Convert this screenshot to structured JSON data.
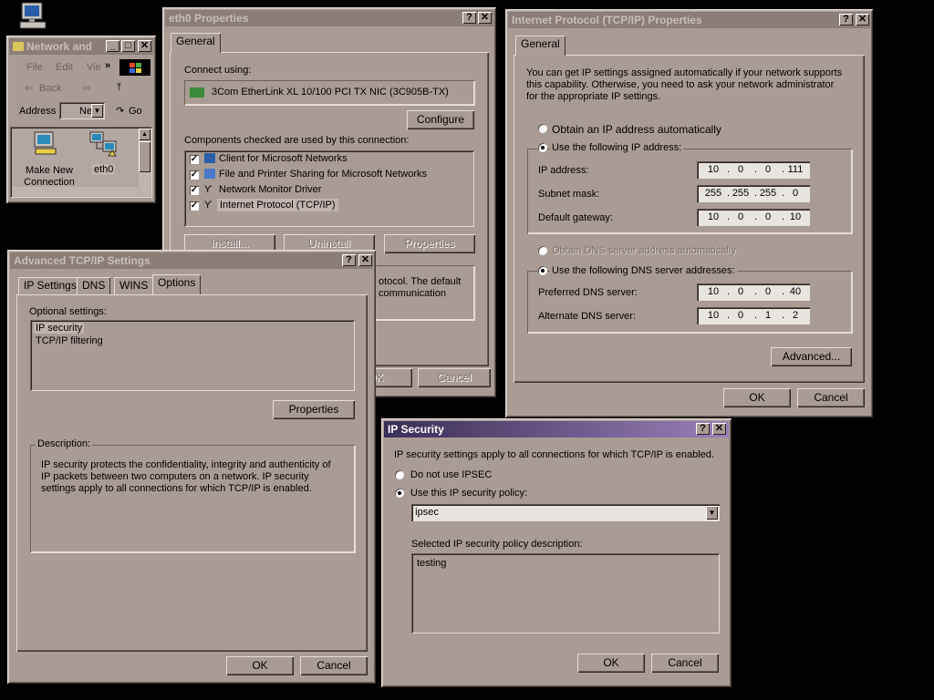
{
  "desktop": {
    "icon": "my-computer-icon"
  },
  "explorer": {
    "title": "Network and",
    "menu": [
      "File",
      "Edit",
      "Vie"
    ],
    "back_label": "Back",
    "address_label": "Address",
    "address_value": "Net",
    "go_label": "Go",
    "items": [
      {
        "label": "Make New\nConnection",
        "icon": "make-new-connection-icon"
      },
      {
        "label": "eth0",
        "icon": "network-connection-icon"
      }
    ]
  },
  "eth0": {
    "title": "eth0 Properties",
    "tab": "General",
    "connect_using_label": "Connect using:",
    "adapter": "3Com EtherLink XL 10/100 PCI TX NIC (3C905B-TX)",
    "configure": "Configure",
    "components_label": "Components checked are used by this connection:",
    "components": [
      {
        "label": "Client for Microsoft Networks",
        "checked": true
      },
      {
        "label": "File and Printer Sharing for Microsoft Networks",
        "checked": true
      },
      {
        "label": "Network Monitor Driver",
        "checked": true
      },
      {
        "label": "Internet Protocol (TCP/IP)",
        "checked": true
      }
    ],
    "install": "Install...",
    "uninstall": "Uninstall",
    "properties": "Properties",
    "desc_line1": "otocol. The default",
    "desc_line2": "communication",
    "ok": "OK",
    "cancel": "Cancel"
  },
  "tcpip": {
    "title": "Internet Protocol (TCP/IP) Properties",
    "tab": "General",
    "intro": "You can get IP settings assigned automatically if your network supports this capability. Otherwise, you need to ask your network administrator for the appropriate IP settings.",
    "auto_ip": "Obtain an IP address automatically",
    "use_ip": "Use the following IP address:",
    "ip_label": "IP address:",
    "ip": [
      "10",
      "0",
      "0",
      "111"
    ],
    "mask_label": "Subnet mask:",
    "mask": [
      "255",
      "255",
      "255",
      "0"
    ],
    "gw_label": "Default gateway:",
    "gw": [
      "10",
      "0",
      "0",
      "10"
    ],
    "auto_dns": "Obtain DNS server address automatically",
    "use_dns": "Use the following DNS server addresses:",
    "pdns_label": "Preferred DNS server:",
    "pdns": [
      "10",
      "0",
      "0",
      "40"
    ],
    "adns_label": "Alternate DNS server:",
    "adns": [
      "10",
      "0",
      "1",
      "2"
    ],
    "advanced": "Advanced...",
    "ok": "OK",
    "cancel": "Cancel"
  },
  "advanced": {
    "title": "Advanced TCP/IP Settings",
    "tabs": [
      "IP Settings",
      "DNS",
      "WINS",
      "Options"
    ],
    "optional_label": "Optional settings:",
    "options": [
      "IP security",
      "TCP/IP filtering"
    ],
    "properties": "Properties",
    "desc_label": "Description:",
    "description": "IP security protects the confidentiality, integrity and authenticity of IP packets between two computers on a network. IP security settings apply to all connections for which TCP/IP is enabled.",
    "ok": "OK",
    "cancel": "Cancel"
  },
  "ipsec": {
    "title": "IP Security",
    "intro": "IP security settings apply to all connections for which TCP/IP is enabled.",
    "no_ipsec": "Do not use IPSEC",
    "use_policy": "Use this IP security policy:",
    "policy": "ipsec",
    "desc_label": "Selected IP security policy description:",
    "desc": "testing",
    "ok": "OK",
    "cancel": "Cancel"
  }
}
